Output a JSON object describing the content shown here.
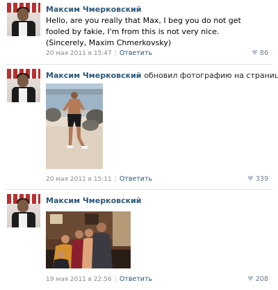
{
  "posts": [
    {
      "author": "Максим Чмерковский",
      "action": "",
      "text": "Hello, are you really that Max, I beg you do not get fooled by fakie, I'm from this is not very nice. (Sincerely, Maxim Chmerkovsky)",
      "date": "20 мая 2011 в 15:47",
      "reply": "Ответить",
      "likes": "86",
      "like_icon": "heart-icon"
    },
    {
      "author": "Максим Чмерковский",
      "action": "обновил фотографию на странице:",
      "photo": "beach-running-photo",
      "date": "20 мая 2011 в 15:11",
      "reply": "Ответить",
      "likes": "339",
      "like_icon": "heart-icon"
    },
    {
      "author": "Максим Чмерковский",
      "action": "",
      "photo": "group-photo",
      "date": "19 мая 2011 в 22:56",
      "reply": "Ответить",
      "likes": "208",
      "like_icon": "heart-icon"
    }
  ],
  "colors": {
    "author_link": "#2b587a",
    "meta_text": "#8a8a8a",
    "divider": "#dfe4ea"
  }
}
